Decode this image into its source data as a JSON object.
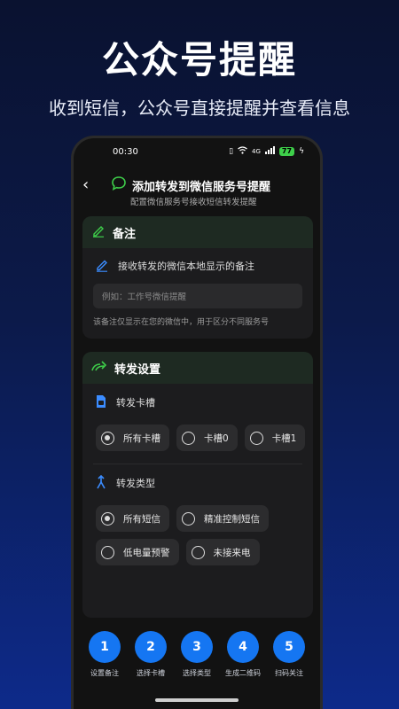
{
  "promo": {
    "title": "公众号提醒",
    "subtitle": "收到短信，公众号直接提醒并查看信息"
  },
  "status_bar": {
    "time": "00:30",
    "network": "4G",
    "battery": "77"
  },
  "app_bar": {
    "title": "添加转发到微信服务号提醒",
    "subtitle": "配置微信服务号接收短信转发提醒"
  },
  "remark_card": {
    "header": "备注",
    "label": "接收转发的微信本地显示的备注",
    "placeholder": "例如：工作号微信提醒",
    "hint": "该备注仅显示在您的微信中，用于区分不同服务号"
  },
  "forward_card": {
    "header": "转发设置",
    "slot_section": {
      "label": "转发卡槽",
      "options": [
        "所有卡槽",
        "卡槽0",
        "卡槽1"
      ],
      "selected": "所有卡槽"
    },
    "type_section": {
      "label": "转发类型",
      "options": [
        "所有短信",
        "精准控制短信",
        "低电量预警",
        "未接来电"
      ],
      "selected": "所有短信"
    }
  },
  "steps": [
    {
      "number": "1",
      "label": "设置备注"
    },
    {
      "number": "2",
      "label": "选择卡槽"
    },
    {
      "number": "3",
      "label": "选择类型"
    },
    {
      "number": "4",
      "label": "生成二维码"
    },
    {
      "number": "5",
      "label": "扫码关注"
    }
  ],
  "colors": {
    "accent_blue": "#1576f2",
    "accent_green": "#3ecf4a",
    "card_bg": "#1c1c1e",
    "card_header_bg": "#1e2a22"
  }
}
